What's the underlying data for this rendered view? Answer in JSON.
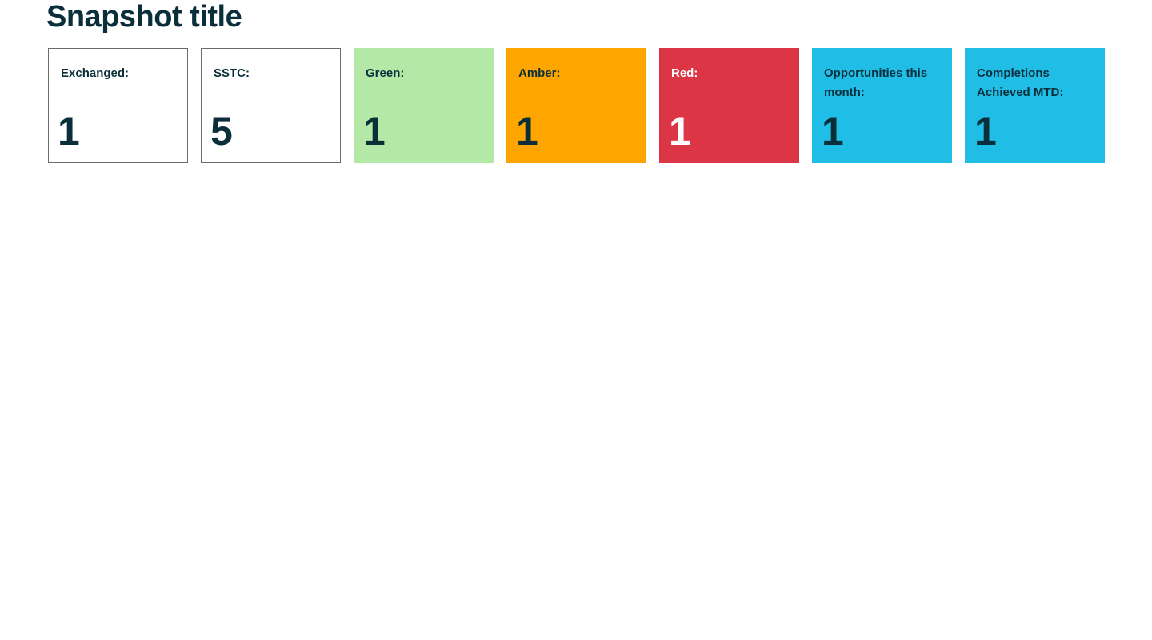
{
  "page": {
    "title": "Snapshot title"
  },
  "cards": [
    {
      "label": "Exchanged:",
      "value": "1",
      "style": "outline",
      "background": "#ffffff"
    },
    {
      "label": "SSTC:",
      "value": "5",
      "style": "outline",
      "background": "#ffffff"
    },
    {
      "label": "Green:",
      "value": "1",
      "style": "filled",
      "background": "#b4e8a6"
    },
    {
      "label": "Amber:",
      "value": "1",
      "style": "filled",
      "background": "#ffa500"
    },
    {
      "label": "Red:",
      "value": "1",
      "style": "filled-light",
      "background": "#dc3545"
    },
    {
      "label": "Opportunities this month:",
      "value": "1",
      "style": "filled",
      "background": "#20bde6"
    },
    {
      "label": "Completions Achieved MTD:",
      "value": "1",
      "style": "filled",
      "background": "#20bde6"
    }
  ]
}
